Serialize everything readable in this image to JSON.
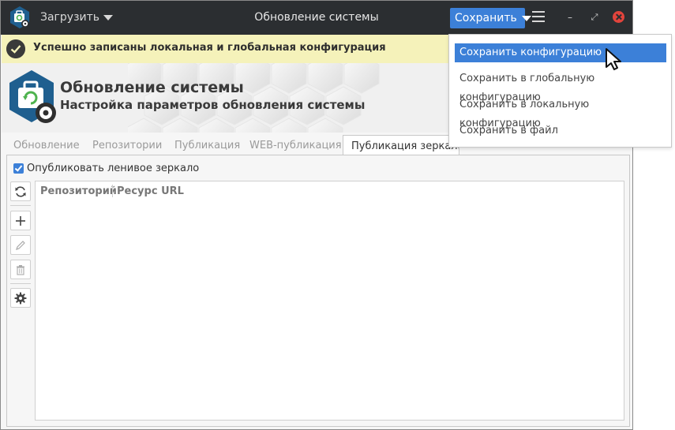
{
  "titlebar": {
    "load_label": "Загрузить",
    "title": "Обновление системы",
    "save_label": "Сохранить"
  },
  "notice": {
    "text": "Успешно записаны локальная и глобальная конфигурация"
  },
  "banner": {
    "title": "Обновление системы",
    "subtitle": "Настройка параметров обновления системы"
  },
  "tabs": [
    {
      "label": "Обновление",
      "active": false
    },
    {
      "label": "Репозитории",
      "active": false
    },
    {
      "label": "Публикация",
      "active": false
    },
    {
      "label": "WEB-публикация",
      "active": false
    },
    {
      "label": "Публикация зеркала",
      "active": true
    }
  ],
  "panel": {
    "checkbox_label": "Опубликовать ленивое зеркало",
    "checkbox_checked": true,
    "columns": [
      "Репозиторий",
      "Ресурс URL"
    ],
    "rows": []
  },
  "save_menu": {
    "items": [
      {
        "label": "Сохранить конфигурацию",
        "highlighted": true
      },
      {
        "label": "Сохранить в глобальную конфигурацию",
        "highlighted": false
      },
      {
        "label": "Сохранить в локальную конфигурацию",
        "highlighted": false
      },
      {
        "label": "Сохранить в файл",
        "highlighted": false
      }
    ]
  },
  "colors": {
    "titlebar": "#2b2e31",
    "accent": "#3c80d8",
    "notice_bg": "#f5f2ba",
    "close": "#e2443c"
  },
  "icons": {
    "app": "app-update-icon",
    "notice": "check-circle-icon",
    "refresh": "refresh-icon",
    "add": "plus-icon",
    "edit": "pencil-icon",
    "delete": "trash-icon",
    "settings": "gear-icon"
  }
}
